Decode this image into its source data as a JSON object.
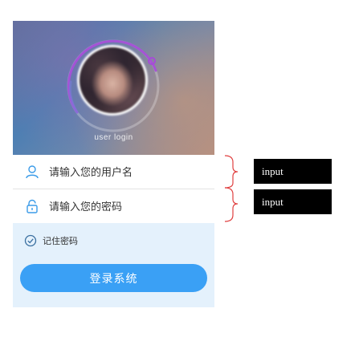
{
  "hero": {
    "caption": "user login"
  },
  "username_field": {
    "placeholder": "请输入您的用户名",
    "icon": "user-icon"
  },
  "password_field": {
    "placeholder": "请输入您的密码",
    "icon": "lock-icon"
  },
  "remember": {
    "label": "记住密码",
    "icon": "check-circle-icon",
    "checked": true
  },
  "login_button": {
    "label": "登录系统"
  },
  "annotations": [
    {
      "label": "input"
    },
    {
      "label": "input"
    }
  ],
  "colors": {
    "accent": "#3aa0f5",
    "panel_bg": "#e4f1fc",
    "ring": "#a64bd8",
    "brace": "#e04040",
    "tag_bg": "#000000"
  }
}
